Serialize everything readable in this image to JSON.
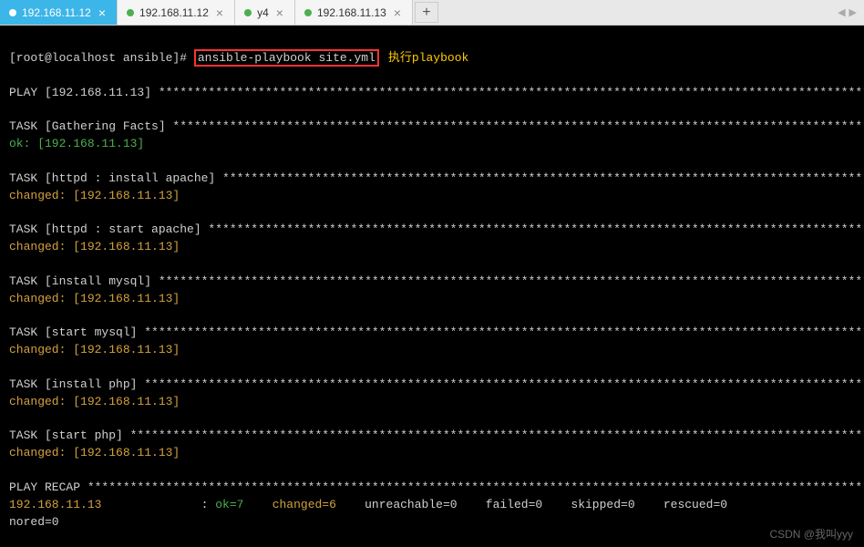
{
  "tabs": [
    {
      "label": "192.168.11.12",
      "active": true
    },
    {
      "label": "192.168.11.12",
      "active": false
    },
    {
      "label": "y4",
      "active": false
    },
    {
      "label": "192.168.11.13",
      "active": false
    }
  ],
  "prompt": {
    "user_host": "[root@localhost ansible]# ",
    "command": "ansible-playbook site.yml",
    "annotation": "执行playbook"
  },
  "output": {
    "play_header": "PLAY [192.168.11.13] ********************************************************************************************************",
    "tasks": [
      {
        "header": "TASK [Gathering Facts] ******************************************************************************************************",
        "status": "ok",
        "status_text": "ok: [192.168.11.13]"
      },
      {
        "header": "TASK [httpd : install apache] ***********************************************************************************************",
        "status": "changed",
        "status_text": "changed: [192.168.11.13]"
      },
      {
        "header": "TASK [httpd : start apache] *************************************************************************************************",
        "status": "changed",
        "status_text": "changed: [192.168.11.13]"
      },
      {
        "header": "TASK [install mysql] ********************************************************************************************************",
        "status": "changed",
        "status_text": "changed: [192.168.11.13]"
      },
      {
        "header": "TASK [start mysql] **********************************************************************************************************",
        "status": "changed",
        "status_text": "changed: [192.168.11.13]"
      },
      {
        "header": "TASK [install php] **********************************************************************************************************",
        "status": "changed",
        "status_text": "changed: [192.168.11.13]"
      },
      {
        "header": "TASK [start php] ************************************************************************************************************",
        "status": "changed",
        "status_text": "changed: [192.168.11.13]"
      }
    ],
    "recap": {
      "header": "PLAY RECAP ******************************************************************************************************************",
      "host": "192.168.11.13",
      "sep": "              : ",
      "ok": "ok=7",
      "changed": "changed=6",
      "unreachable": "unreachable=0",
      "failed": "failed=0",
      "skipped": "skipped=0",
      "rescued": "rescued=0",
      "nored": "nored=0"
    }
  },
  "watermark": "CSDN @我叫yyy",
  "nav": {
    "left": "◀",
    "right": "▶"
  }
}
